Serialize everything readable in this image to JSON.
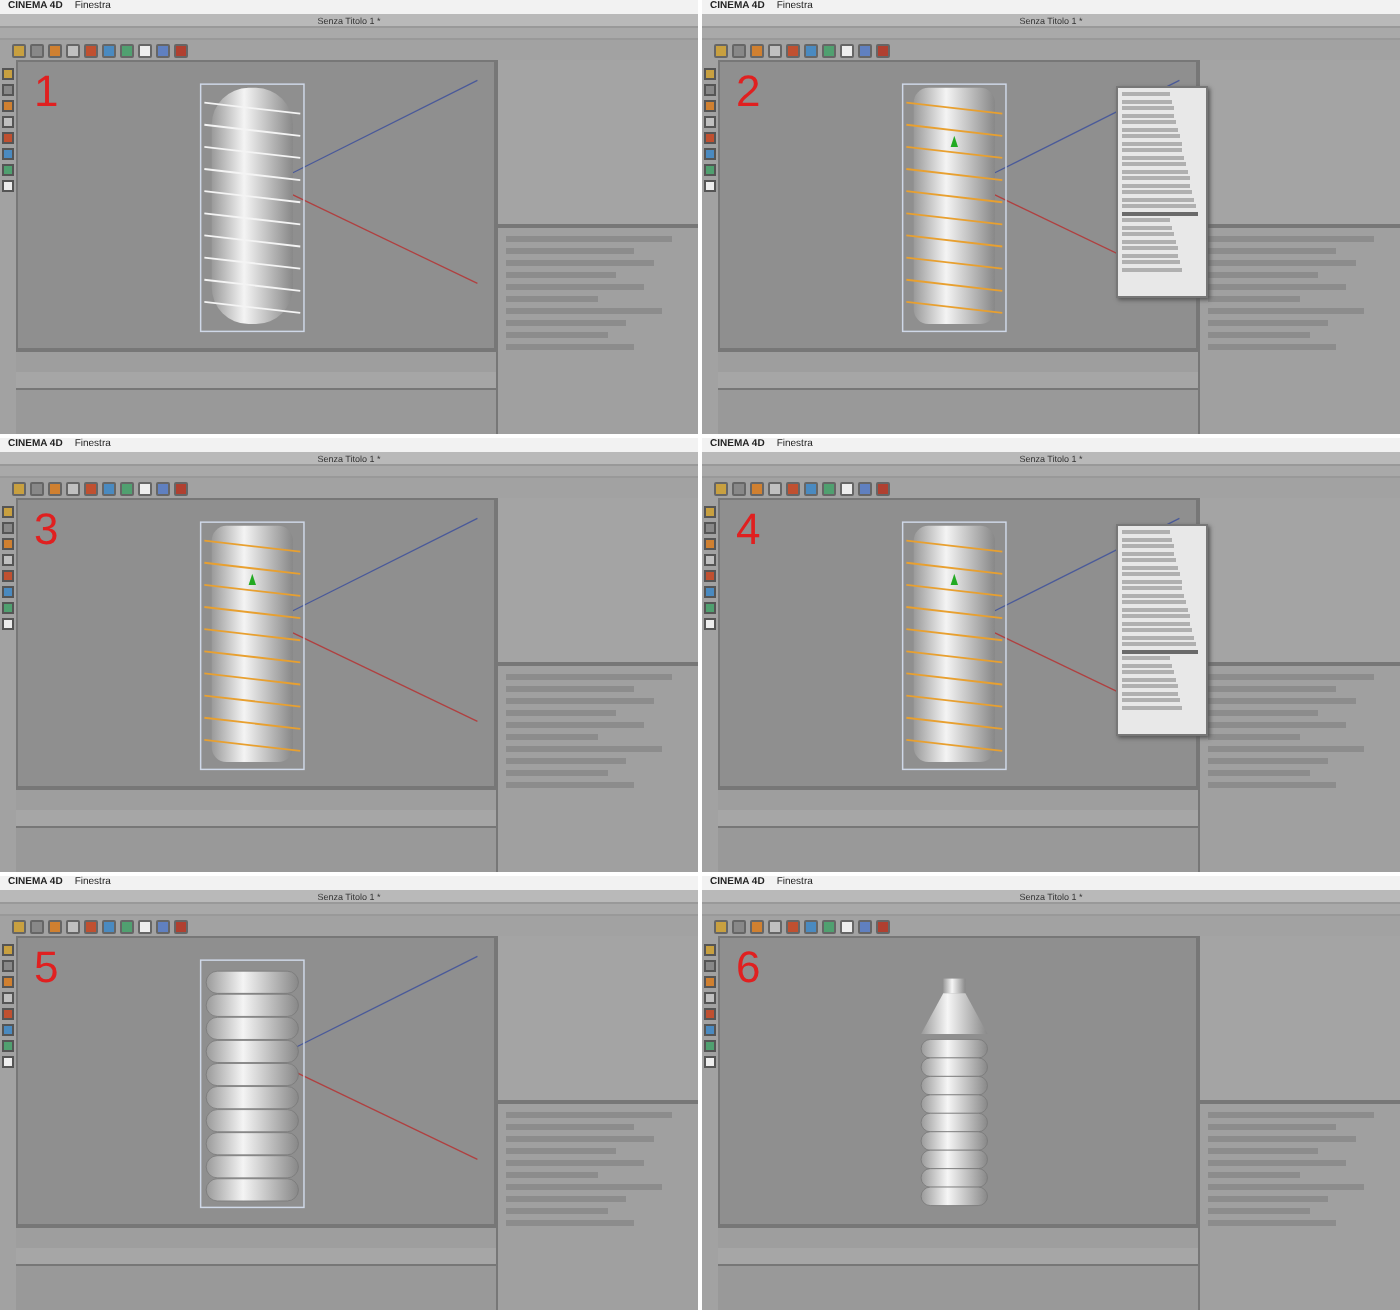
{
  "panels": [
    {
      "number": "1",
      "app_name": "CINEMA 4D",
      "app_menu": "Finestra",
      "window_title": "Senza Titolo 1 *",
      "kind": "capsule",
      "popup_menu": false
    },
    {
      "number": "2",
      "app_name": "CINEMA 4D",
      "app_menu": "Finestra",
      "window_title": "Senza Titolo 1 *",
      "kind": "helix",
      "popup_menu": true
    },
    {
      "number": "3",
      "app_name": "CINEMA 4D",
      "app_menu": "Finestra",
      "window_title": "Senza Titolo 1 *",
      "kind": "helix",
      "popup_menu": false
    },
    {
      "number": "4",
      "app_name": "CINEMA 4D",
      "app_menu": "Finestra",
      "window_title": "Senza Titolo 1 *",
      "kind": "helix",
      "popup_menu": true
    },
    {
      "number": "5",
      "app_name": "CINEMA 4D",
      "app_menu": "Finestra",
      "window_title": "Senza Titolo 1 *",
      "kind": "ribbed",
      "popup_menu": false
    },
    {
      "number": "6",
      "app_name": "CINEMA 4D",
      "app_menu": "Finestra",
      "window_title": "Senza Titolo 1 *",
      "kind": "bottle",
      "popup_menu": false
    }
  ]
}
